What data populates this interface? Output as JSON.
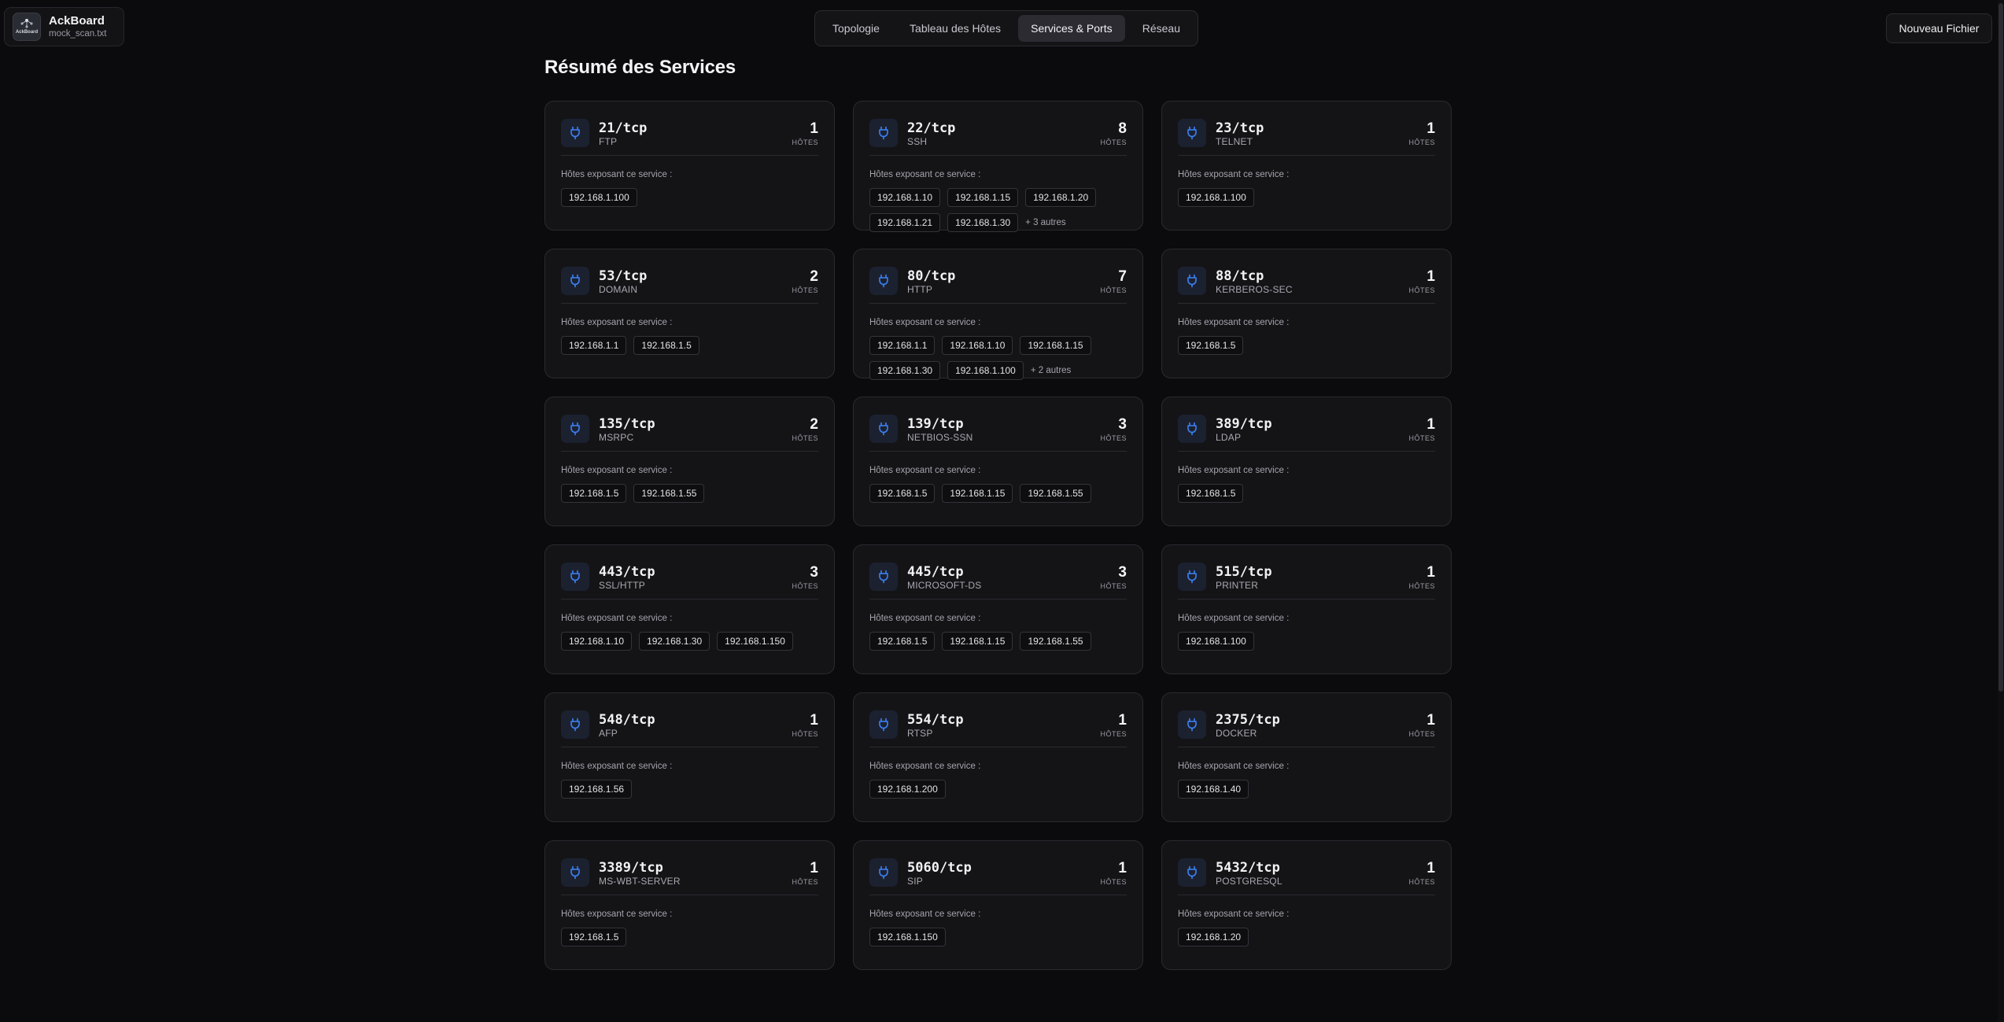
{
  "brand": {
    "name": "AckBoard",
    "file": "mock_scan.txt",
    "logo_text": "AckBoard"
  },
  "nav": {
    "tabs": [
      {
        "label": "Topologie",
        "active": false
      },
      {
        "label": "Tableau des Hôtes",
        "active": false
      },
      {
        "label": "Services & Ports",
        "active": true
      },
      {
        "label": "Réseau",
        "active": false
      }
    ]
  },
  "actions": {
    "new_file": "Nouveau Fichier"
  },
  "page": {
    "title": "Résumé des Services",
    "hosts_label": "Hôtes exposant ce service :",
    "host_unit": "HÔTES"
  },
  "colors": {
    "accent": "#3b82f6",
    "card_bg": "#141417",
    "page_bg": "#0b0b0d"
  },
  "icons": {
    "service": "plug-icon",
    "brand": "network-icon"
  },
  "services": [
    {
      "port": "21/tcp",
      "name": "FTP",
      "count": "1",
      "hosts": [
        "192.168.1.100"
      ],
      "more": ""
    },
    {
      "port": "22/tcp",
      "name": "SSH",
      "count": "8",
      "hosts": [
        "192.168.1.10",
        "192.168.1.15",
        "192.168.1.20",
        "192.168.1.21",
        "192.168.1.30"
      ],
      "more": "+ 3 autres"
    },
    {
      "port": "23/tcp",
      "name": "TELNET",
      "count": "1",
      "hosts": [
        "192.168.1.100"
      ],
      "more": ""
    },
    {
      "port": "53/tcp",
      "name": "DOMAIN",
      "count": "2",
      "hosts": [
        "192.168.1.1",
        "192.168.1.5"
      ],
      "more": ""
    },
    {
      "port": "80/tcp",
      "name": "HTTP",
      "count": "7",
      "hosts": [
        "192.168.1.1",
        "192.168.1.10",
        "192.168.1.15",
        "192.168.1.30",
        "192.168.1.100"
      ],
      "more": "+ 2 autres"
    },
    {
      "port": "88/tcp",
      "name": "KERBEROS-SEC",
      "count": "1",
      "hosts": [
        "192.168.1.5"
      ],
      "more": ""
    },
    {
      "port": "135/tcp",
      "name": "MSRPC",
      "count": "2",
      "hosts": [
        "192.168.1.5",
        "192.168.1.55"
      ],
      "more": ""
    },
    {
      "port": "139/tcp",
      "name": "NETBIOS-SSN",
      "count": "3",
      "hosts": [
        "192.168.1.5",
        "192.168.1.15",
        "192.168.1.55"
      ],
      "more": ""
    },
    {
      "port": "389/tcp",
      "name": "LDAP",
      "count": "1",
      "hosts": [
        "192.168.1.5"
      ],
      "more": ""
    },
    {
      "port": "443/tcp",
      "name": "SSL/HTTP",
      "count": "3",
      "hosts": [
        "192.168.1.10",
        "192.168.1.30",
        "192.168.1.150"
      ],
      "more": ""
    },
    {
      "port": "445/tcp",
      "name": "MICROSOFT-DS",
      "count": "3",
      "hosts": [
        "192.168.1.5",
        "192.168.1.15",
        "192.168.1.55"
      ],
      "more": ""
    },
    {
      "port": "515/tcp",
      "name": "PRINTER",
      "count": "1",
      "hosts": [
        "192.168.1.100"
      ],
      "more": ""
    },
    {
      "port": "548/tcp",
      "name": "AFP",
      "count": "1",
      "hosts": [
        "192.168.1.56"
      ],
      "more": ""
    },
    {
      "port": "554/tcp",
      "name": "RTSP",
      "count": "1",
      "hosts": [
        "192.168.1.200"
      ],
      "more": ""
    },
    {
      "port": "2375/tcp",
      "name": "DOCKER",
      "count": "1",
      "hosts": [
        "192.168.1.40"
      ],
      "more": ""
    },
    {
      "port": "3389/tcp",
      "name": "MS-WBT-SERVER",
      "count": "1",
      "hosts": [
        "192.168.1.5"
      ],
      "more": ""
    },
    {
      "port": "5060/tcp",
      "name": "SIP",
      "count": "1",
      "hosts": [
        "192.168.1.150"
      ],
      "more": ""
    },
    {
      "port": "5432/tcp",
      "name": "POSTGRESQL",
      "count": "1",
      "hosts": [
        "192.168.1.20"
      ],
      "more": ""
    }
  ]
}
